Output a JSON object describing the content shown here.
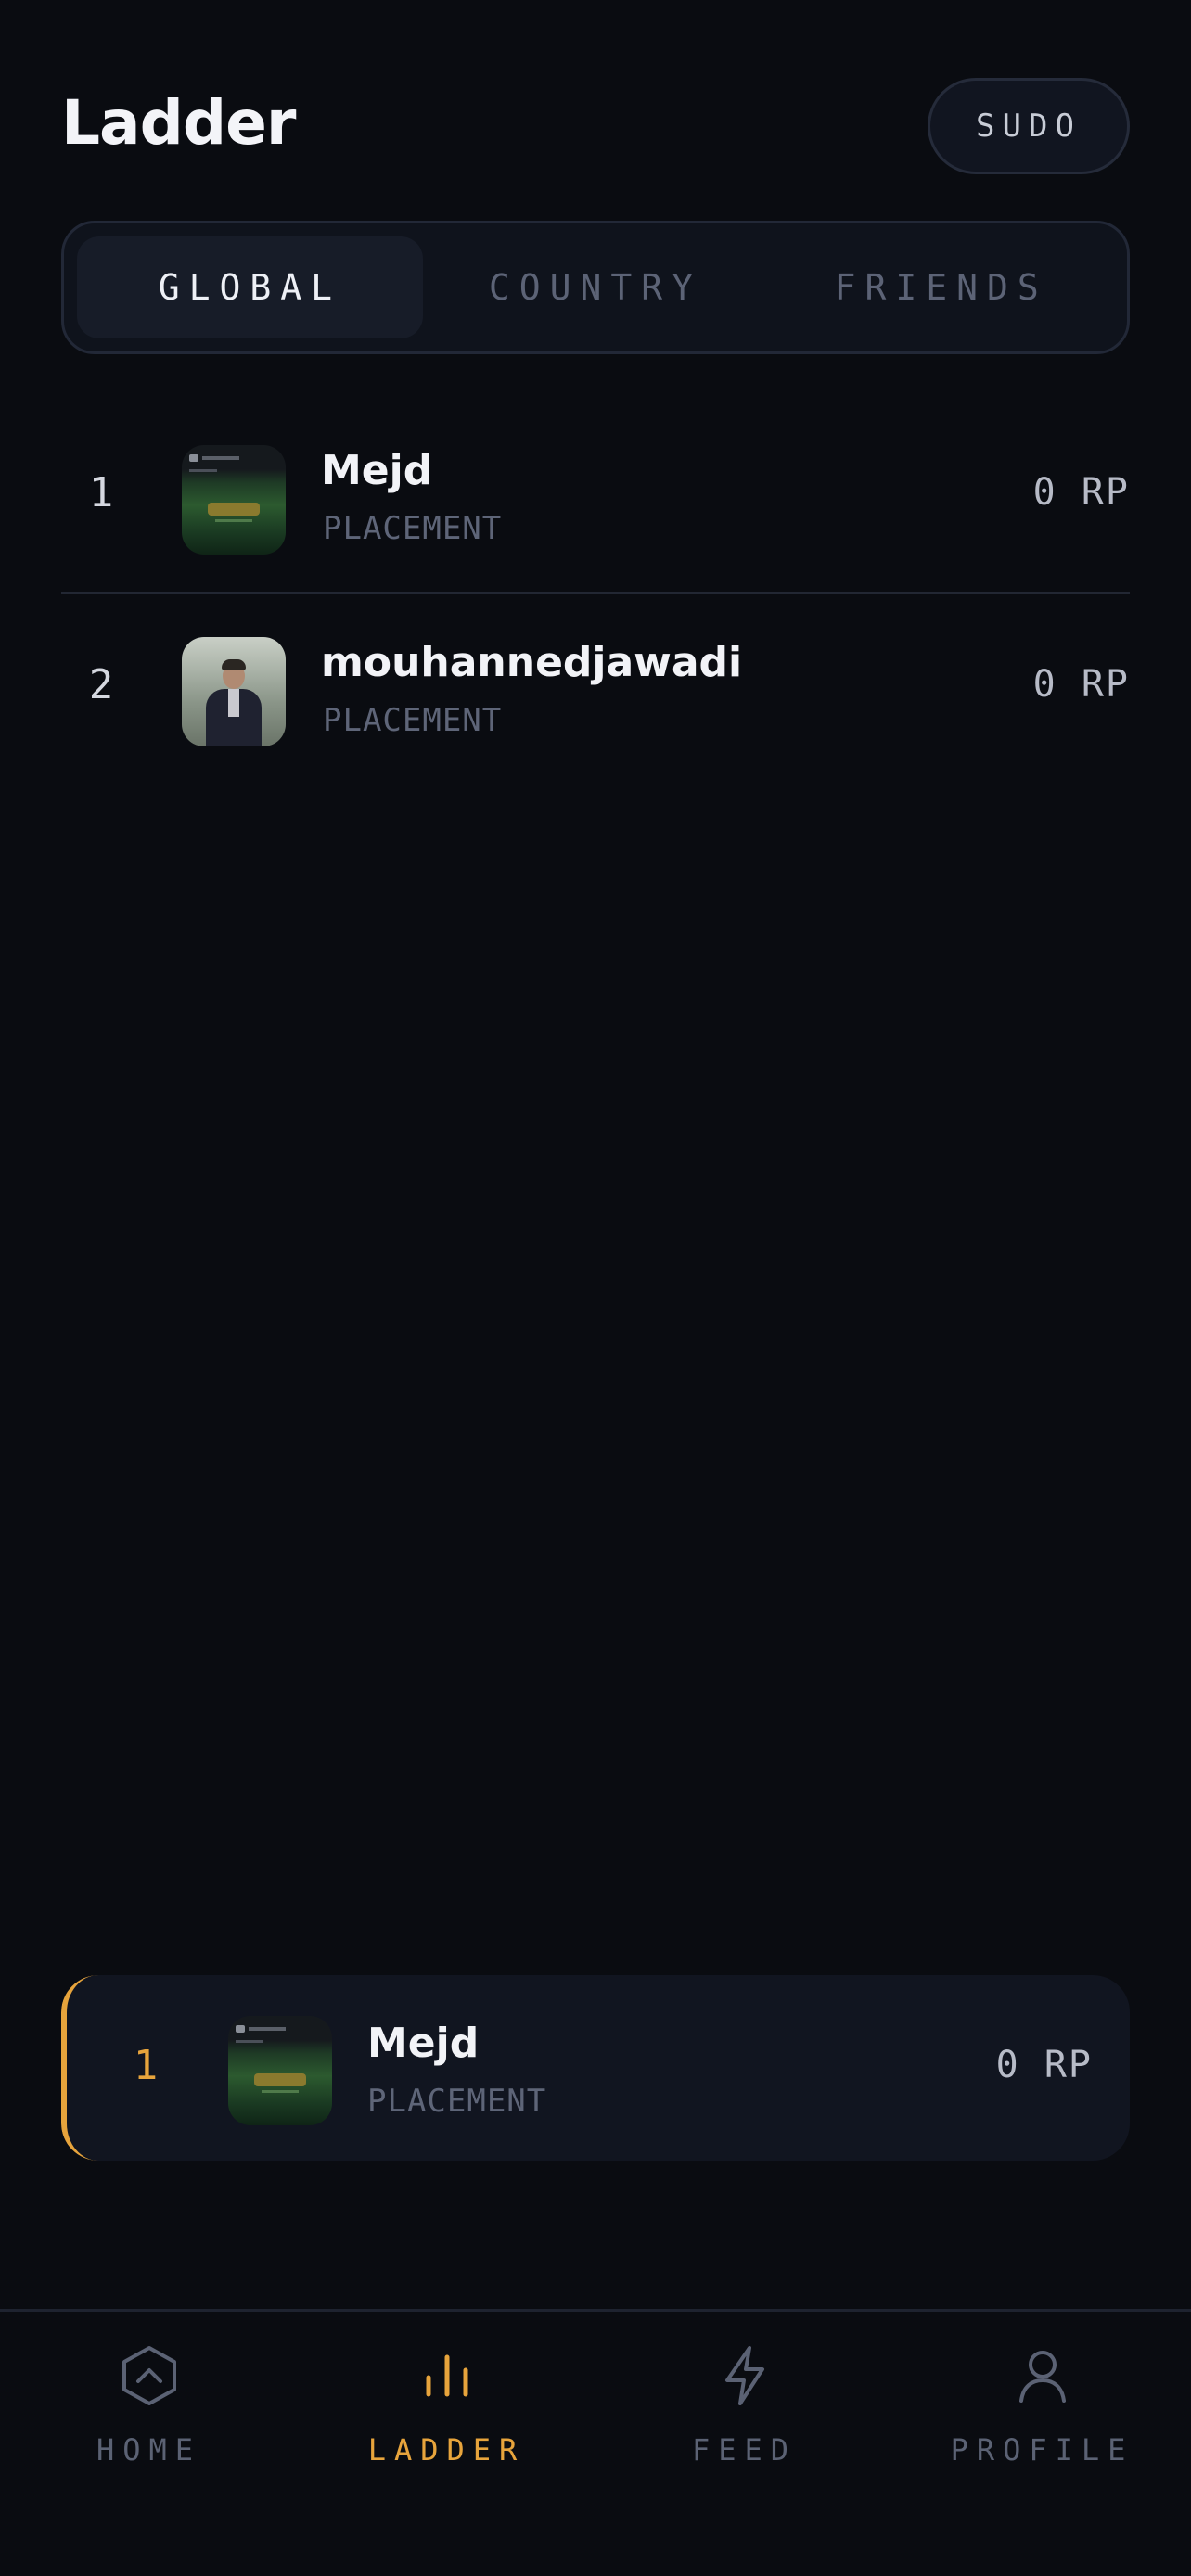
{
  "header": {
    "title": "Ladder",
    "sudo_label": "SUDO"
  },
  "tabs": [
    {
      "label": "GLOBAL",
      "active": true
    },
    {
      "label": "COUNTRY",
      "active": false
    },
    {
      "label": "FRIENDS",
      "active": false
    }
  ],
  "ladder": [
    {
      "rank": "1",
      "name": "Mejd",
      "tier": "PLACEMENT",
      "points": "0 RP"
    },
    {
      "rank": "2",
      "name": "mouhannedjawadi",
      "tier": "PLACEMENT",
      "points": "0 RP"
    }
  ],
  "current_user": {
    "rank": "1",
    "name": "Mejd",
    "tier": "PLACEMENT",
    "points": "0 RP"
  },
  "nav": [
    {
      "label": "HOME",
      "icon": "hexagon-chevron-up-icon",
      "active": false
    },
    {
      "label": "LADDER",
      "icon": "bar-chart-icon",
      "active": true
    },
    {
      "label": "FEED",
      "icon": "lightning-bolt-icon",
      "active": false
    },
    {
      "label": "PROFILE",
      "icon": "person-icon",
      "active": false
    }
  ],
  "colors": {
    "background": "#0a0c11",
    "accent": "#e7a43c",
    "muted": "#5b6274"
  }
}
